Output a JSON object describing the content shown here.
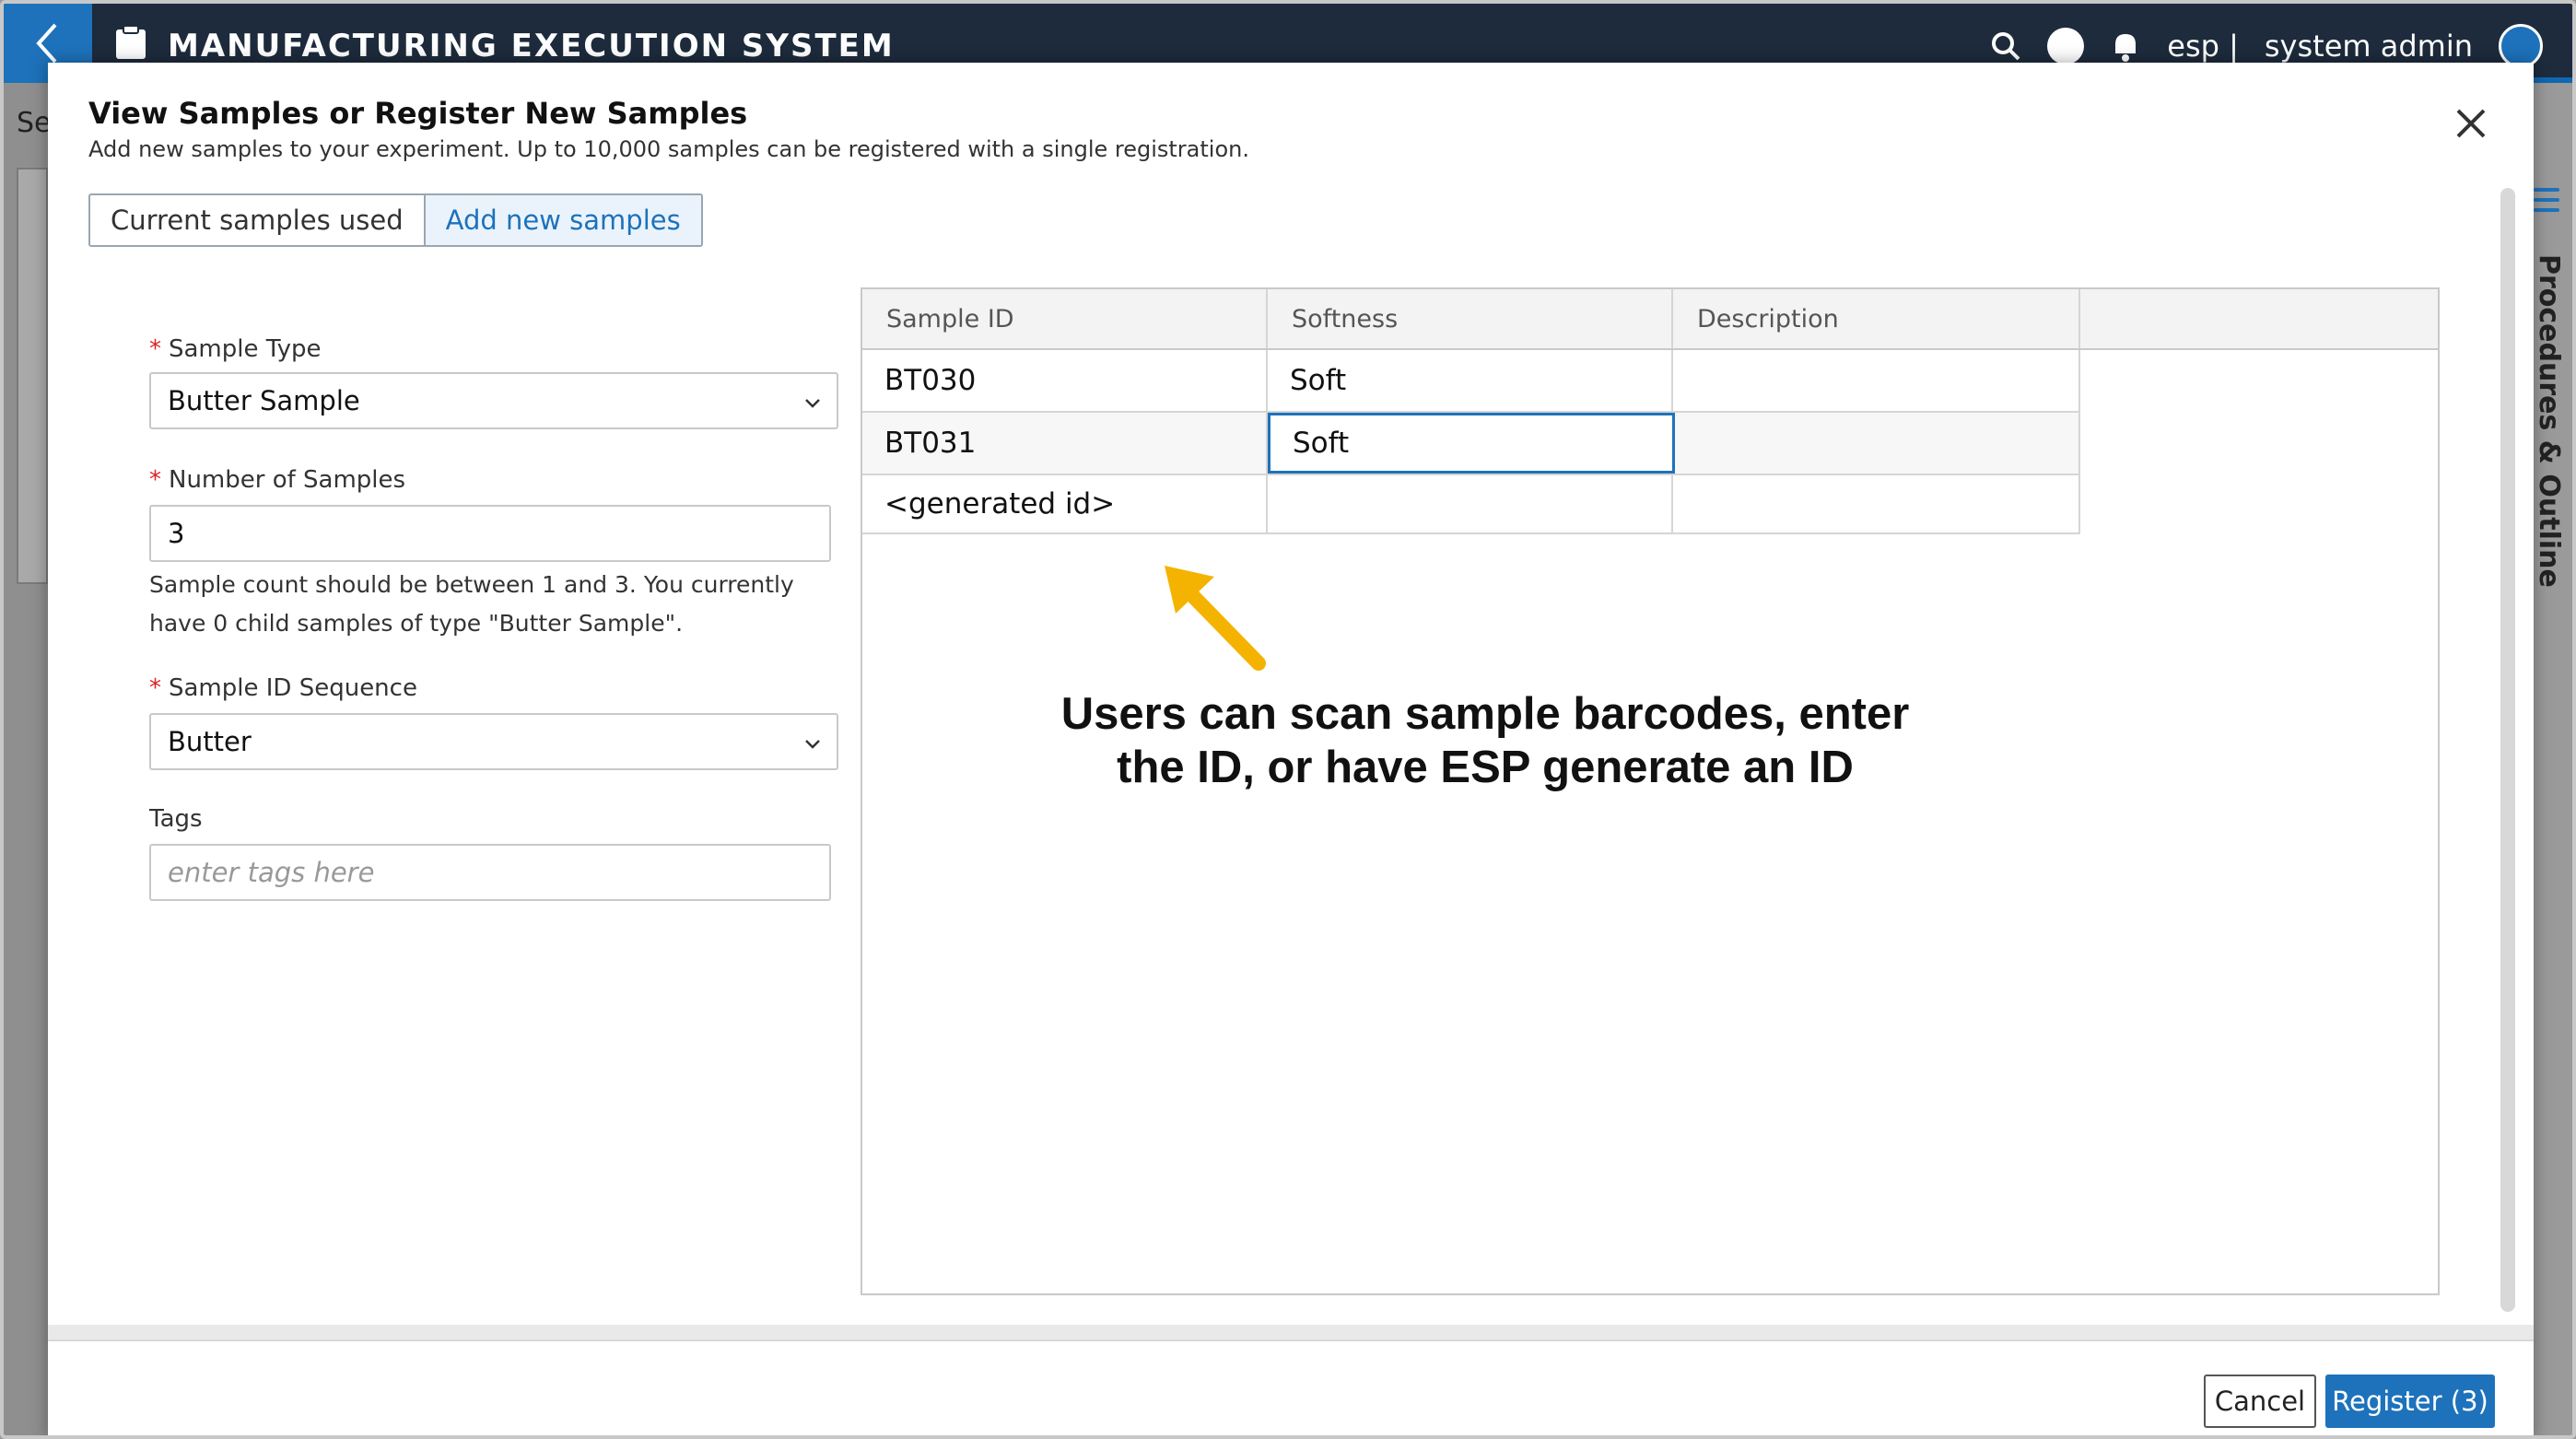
{
  "app": {
    "title": "MANUFACTURING EXECUTION SYSTEM",
    "user_prefix": "esp |",
    "user_name": "system admin",
    "left_partial_text": "Se",
    "side_panel_label": "Procedures & Outline"
  },
  "modal": {
    "title": "View Samples or Register New Samples",
    "subtitle": "Add new samples to your experiment. Up to 10,000 samples can be registered with a single registration.",
    "tabs": [
      {
        "label": "Current samples used",
        "active": false
      },
      {
        "label": "Add new samples",
        "active": true
      }
    ]
  },
  "form": {
    "required_marker": "*",
    "sample_type": {
      "label": "Sample Type",
      "value": "Butter Sample"
    },
    "number_of_samples": {
      "label": "Number of Samples",
      "value": "3"
    },
    "help_text": "Sample count should be between 1 and 3. You currently have 0 child samples of type \"Butter Sample\".",
    "sample_id_sequence": {
      "label": "Sample ID Sequence",
      "value": "Butter"
    },
    "tags": {
      "label": "Tags",
      "placeholder": "enter tags here"
    }
  },
  "grid": {
    "columns": [
      "Sample ID",
      "Softness",
      "Description"
    ],
    "rows": [
      {
        "sample_id": "BT030",
        "softness": "Soft",
        "description": ""
      },
      {
        "sample_id": "BT031",
        "softness": "Soft",
        "description": ""
      },
      {
        "sample_id": "<generated id>",
        "softness": "",
        "description": ""
      }
    ]
  },
  "annotation": {
    "line1": "Users can scan sample barcodes, enter",
    "line2": "the ID, or have ESP generate an ID"
  },
  "footer": {
    "cancel_label": "Cancel",
    "register_label": "Register (3)"
  },
  "colors": {
    "accent": "#1d72bb",
    "topbar": "#1d2b3c",
    "arrow": "#f5b301",
    "required": "#dd2222"
  },
  "icons": [
    "back-chevron-icon",
    "clipboard-icon",
    "search-icon",
    "help-icon",
    "bell-icon",
    "avatar-icon",
    "list-menu-icon",
    "close-icon",
    "chevron-down-icon",
    "arrow-pointer-icon"
  ]
}
